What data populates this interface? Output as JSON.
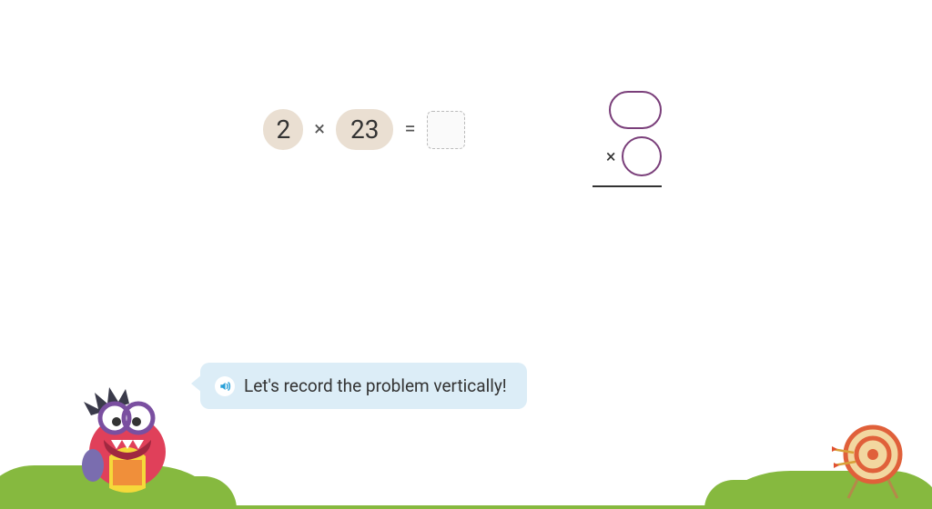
{
  "problem": {
    "multiplier": "2",
    "times_symbol": "×",
    "multiplicand": "23",
    "equals_symbol": "="
  },
  "vertical": {
    "times_symbol": "×"
  },
  "speech": {
    "text": "Let's record the problem vertically!"
  }
}
